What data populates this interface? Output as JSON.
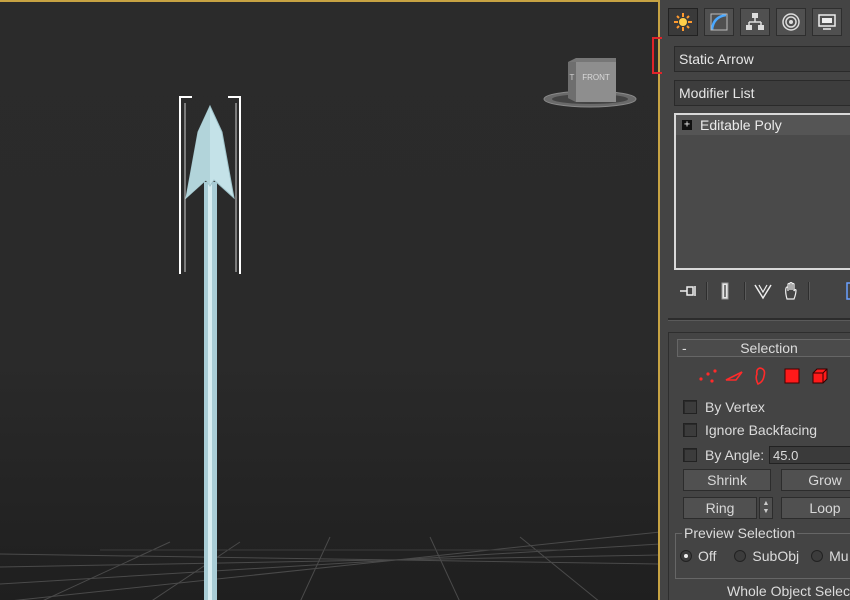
{
  "command_panel": {
    "tabs": [
      {
        "name": "create-tab-icon",
        "active": true
      },
      {
        "name": "modify-tab-icon",
        "active": false
      },
      {
        "name": "hierarchy-tab-icon",
        "active": false
      },
      {
        "name": "motion-tab-icon",
        "active": false
      },
      {
        "name": "display-tab-icon",
        "active": false
      }
    ],
    "object_name": "Static Arrow",
    "modifier_list_label": "Modifier List",
    "modifier_stack": [
      {
        "label": "Editable Poly",
        "expand_symbol": "+"
      }
    ],
    "stack_tools": [
      "pin-stack-icon",
      "show-end-result-icon",
      "make-unique-icon",
      "remove-modifier-icon",
      "configure-modifier-sets-icon"
    ]
  },
  "selection_rollout": {
    "collapse_symbol": "-",
    "title": "Selection",
    "subobject_levels": [
      "vertex-icon",
      "edge-icon",
      "border-icon",
      "polygon-icon",
      "element-icon"
    ],
    "by_vertex_label": "By Vertex",
    "ignore_backfacing_label": "Ignore Backfacing",
    "by_angle_label": "By Angle:",
    "by_angle_value": "45.0",
    "shrink_label": "Shrink",
    "grow_label": "Grow",
    "ring_label": "Ring",
    "loop_label": "Loop",
    "preview_selection": {
      "label": "Preview Selection",
      "options": [
        {
          "label": "Off",
          "selected": true
        },
        {
          "label": "SubObj",
          "selected": false
        },
        {
          "label": "Mu",
          "selected": false
        }
      ]
    },
    "status_text": "Whole Object Selecte"
  },
  "viewport": {
    "viewcube_face_label": "FRONT",
    "viewcube_side_label": "T",
    "background": "#2b2b2b",
    "frame_border_color": "#c7a343",
    "highlight_color": "#e0242a",
    "arrow_color": "#bfe0e6"
  }
}
